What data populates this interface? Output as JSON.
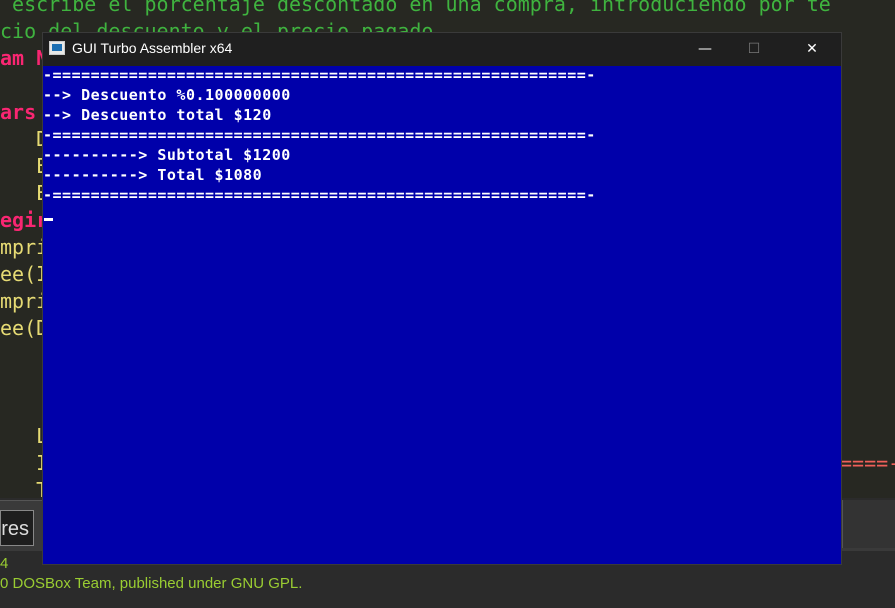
{
  "editor": {
    "lines": [
      {
        "text": " escribe el porcentaje descontado en una compra, introduciendo por te",
        "color": "#3fb33f"
      },
      {
        "text": "cio del descuento y el precio pagado.",
        "color": "#3fb33f"
      },
      {
        "text": "am N",
        "color": "#f92672"
      },
      {
        "text": "",
        "color": "#f8f8f2"
      },
      {
        "text": "ars ",
        "color": "#f92672"
      },
      {
        "text": "   D",
        "color": "#e6db74"
      },
      {
        "text": "   E",
        "color": "#e6db74"
      },
      {
        "text": "   E",
        "color": "#e6db74"
      },
      {
        "text": "egir",
        "color": "#f92672"
      },
      {
        "text": "mpri",
        "color": "#e6db74"
      },
      {
        "text": "ee(I",
        "color": "#e6db74"
      },
      {
        "text": "mpri",
        "color": "#e6db74"
      },
      {
        "text": "ee(D",
        "color": "#e6db74"
      },
      {
        "text": "",
        "color": "#f8f8f2"
      },
      {
        "text": "",
        "color": "#f8f8f2"
      },
      {
        "text": "",
        "color": "#f8f8f2"
      },
      {
        "text": "   L",
        "color": "#e6db74"
      },
      {
        "text": "   I",
        "color": "#e6db74"
      },
      {
        "text": "   T",
        "color": "#e6db74"
      }
    ],
    "right_fragment": "====-"
  },
  "panel": {
    "tab_label": "res"
  },
  "status": {
    "line1": "4",
    "line2": "0 DOSBox Team, published under GNU GPL."
  },
  "window": {
    "title": "GUI Turbo Assembler x64",
    "minimize_glyph": "—",
    "maximize_glyph": "☐",
    "close_glyph": "✕"
  },
  "console": {
    "lines": [
      "-========================================================-",
      "--> Descuento %0.100000000",
      "--> Descuento total $120",
      "-========================================================-",
      "----------> Subtotal $1200",
      "----------> Total $1080",
      "-========================================================-"
    ]
  }
}
